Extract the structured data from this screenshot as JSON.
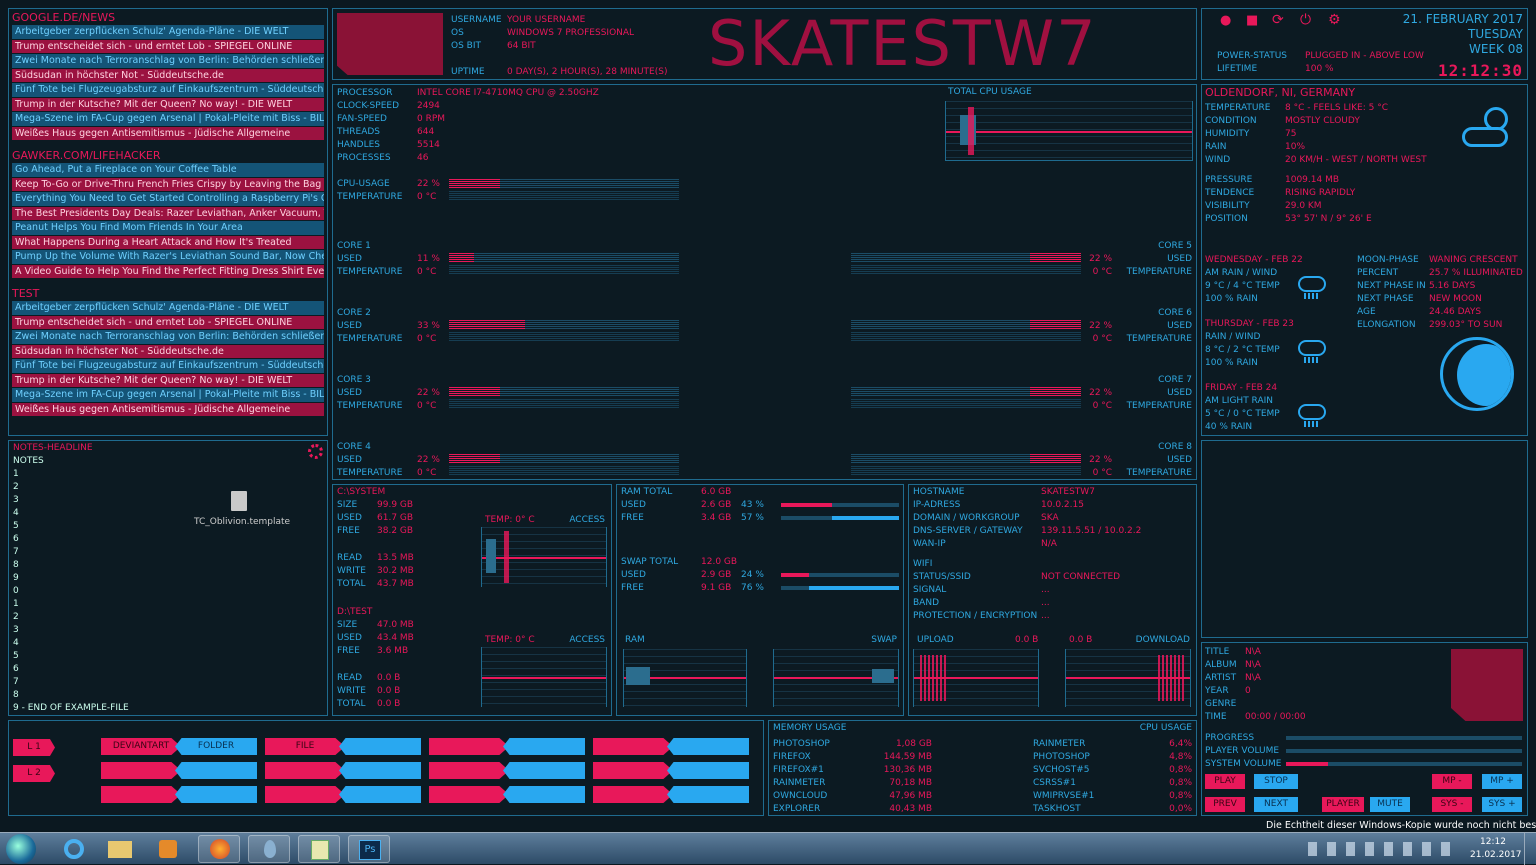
{
  "news": {
    "sections": [
      {
        "title": "GOOGLE.DE/NEWS",
        "items": [
          "Arbeitgeber zerpflücken Schulz' Agenda-Pläne - DIE WELT",
          "Trump entscheidet sich - und erntet Lob - SPIEGEL ONLINE",
          "Zwei Monate nach Terroranschlag von Berlin: Behörden schließen Fuss...",
          "Südsudan in höchster Not - Süddeutsche.de",
          "Fünf Tote bei Flugzeugabsturz auf Einkaufszentrum - Süddeutsche.de",
          "Trump in der Kutsche? Mit der Queen? No way! - DIE WELT",
          "Mega-Szene im FA-Cup gegen Arsenal | Pokal-Pleite mit Biss - BILD",
          "Weißes Haus gegen Antisemitismus - Jüdische Allgemeine"
        ]
      },
      {
        "title": "GAWKER.COM/LIFEHACKER",
        "items": [
          "Go Ahead, Put a Fireplace on Your Coffee Table",
          "Keep To-Go or Drive-Thru French Fries Crispy by Leaving the Bag Open",
          "Everything You Need to Get Started Controlling a Raspberry Pi's GPIO...",
          "The Best Presidents Day Deals: Razer Leviathan, Anker Vacuum, Tiny P...",
          "Peanut Helps You Find Mom Friends In Your Area",
          "What Happens During a Heart Attack and How It's Treated",
          "Pump Up the Volume With Razer's Leviathan Sound Bar, Now Cheaper...",
          "A Video Guide to Help You Find the Perfect Fitting Dress Shirt Every Ti..."
        ]
      },
      {
        "title": "TEST",
        "items": [
          "Arbeitgeber zerpflücken Schulz' Agenda-Pläne - DIE WELT",
          "Trump entscheidet sich - und erntet Lob - SPIEGEL ONLINE",
          "Zwei Monate nach Terroranschlag von Berlin: Behörden schließen Fuss...",
          "Südsudan in höchster Not - Süddeutsche.de",
          "Fünf Tote bei Flugzeugabsturz auf Einkaufszentrum - Süddeutsche.de",
          "Trump in der Kutsche? Mit der Queen? No way! - DIE WELT",
          "Mega-Szene im FA-Cup gegen Arsenal | Pokal-Pleite mit Biss - BILD",
          "Weißes Haus gegen Antisemitismus - Jüdische Allgemeine"
        ]
      }
    ]
  },
  "notes": {
    "headline": "NOTES-HEADLINE",
    "label": "NOTES",
    "lines": [
      "1",
      "2",
      "3",
      "4",
      "5",
      "6",
      "7",
      "8",
      "9",
      "0",
      "1",
      "2",
      "3",
      "4",
      "5",
      "6",
      "7",
      "8",
      "9 - END OF EXAMPLE-FILE"
    ],
    "file_name": "TC_Oblivion.template"
  },
  "user": {
    "hostname_big": "SKATESTW7",
    "labels": [
      "USERNAME",
      "OS",
      "OS BIT",
      "UPTIME"
    ],
    "values": [
      "YOUR USERNAME",
      "WINDOWS 7 PROFESSIONAL",
      "64 BIT",
      "0 DAY(S), 2 HOUR(S), 28 MINUTE(S)"
    ]
  },
  "status": {
    "date": "21. FEBRUARY 2017",
    "day": "TUESDAY",
    "week": "WEEK 08",
    "power_label": "POWER-STATUS",
    "power_value": "PLUGGED IN - ABOVE LOW",
    "lifetime_label": "LIFETIME",
    "lifetime_value": "100 %",
    "clock": "12:12:30"
  },
  "cpu": {
    "labels": [
      "PROCESSOR",
      "CLOCK-SPEED",
      "FAN-SPEED",
      "THREADS",
      "HANDLES",
      "PROCESSES"
    ],
    "values": [
      "INTEL CORE I7-4710MQ CPU @ 2.50GHZ",
      "2494",
      "0 RPM",
      "644",
      "5514",
      "46"
    ],
    "usage_label": "CPU-USAGE",
    "usage_value": "22 %",
    "usage_pct": 22,
    "temp_label": "TEMPERATURE",
    "temp_value": "0 °C",
    "graph_title": "TOTAL CPU USAGE",
    "used_label": "USED",
    "cores": [
      {
        "name": "CORE 1",
        "used": "11 %",
        "pct": 11,
        "temp": "0 °C"
      },
      {
        "name": "CORE 2",
        "used": "33 %",
        "pct": 33,
        "temp": "0 °C"
      },
      {
        "name": "CORE 3",
        "used": "22 %",
        "pct": 22,
        "temp": "0 °C"
      },
      {
        "name": "CORE 4",
        "used": "22 %",
        "pct": 22,
        "temp": "0 °C"
      },
      {
        "name": "CORE 5",
        "used": "22 %",
        "pct": 22,
        "temp": "0 °C"
      },
      {
        "name": "CORE 6",
        "used": "22 %",
        "pct": 22,
        "temp": "0 °C"
      },
      {
        "name": "CORE 7",
        "used": "22 %",
        "pct": 22,
        "temp": "0 °C"
      },
      {
        "name": "CORE 8",
        "used": "22 %",
        "pct": 22,
        "temp": "0 °C"
      }
    ]
  },
  "weather": {
    "location": "OLDENDORF, NI, GERMANY",
    "labels": [
      "TEMPERATURE",
      "CONDITION",
      "HUMIDITY",
      "RAIN",
      "WIND"
    ],
    "values": [
      "8 °C - FEELS LIKE: 5 °C",
      "MOSTLY CLOUDY",
      "75",
      "10%",
      "20 KM/H - WEST / NORTH WEST"
    ],
    "labels2": [
      "PRESSURE",
      "TENDENCE",
      "VISIBILITY",
      "POSITION"
    ],
    "values2": [
      "1009.14 MB",
      "RISING RAPIDLY",
      "29.0 KM",
      "53° 57' N / 9° 26' E"
    ],
    "forecast": [
      {
        "day": "WEDNESDAY - FEB 22",
        "cond": "AM RAIN / WIND",
        "temp": "9 °C / 4 °C TEMP",
        "rain": "100 % RAIN"
      },
      {
        "day": "THURSDAY - FEB 23",
        "cond": "RAIN / WIND",
        "temp": "8 °C / 2 °C TEMP",
        "rain": "100 % RAIN"
      },
      {
        "day": "FRIDAY - FEB 24",
        "cond": "AM LIGHT RAIN",
        "temp": "5 °C / 0 °C TEMP",
        "rain": "40 % RAIN"
      }
    ],
    "moon_labels": [
      "MOON-PHASE",
      "PERCENT",
      "NEXT PHASE IN",
      "NEXT PHASE",
      "AGE",
      "ELONGATION"
    ],
    "moon_values": [
      "WANING CRESCENT",
      "25.7 % ILLUMINATED",
      "5.16 DAYS",
      "NEW MOON",
      "24.46 DAYS",
      "299.03° TO SUN"
    ]
  },
  "drives": {
    "c": {
      "name": "C:\\SYSTEM",
      "labels": [
        "SIZE",
        "USED",
        "FREE",
        "READ",
        "WRITE",
        "TOTAL"
      ],
      "values": [
        "99.9 GB",
        "61.7 GB",
        "38.2 GB",
        "13.5 MB",
        "30.2 MB",
        "43.7 MB"
      ],
      "temp": "TEMP: 0° C",
      "access": "ACCESS"
    },
    "d": {
      "name": "D:\\TEST",
      "labels": [
        "SIZE",
        "USED",
        "FREE",
        "READ",
        "WRITE",
        "TOTAL"
      ],
      "values": [
        "47.0 MB",
        "43.4 MB",
        "3.6 MB",
        "0.0 B",
        "0.0 B",
        "0.0 B"
      ],
      "temp": "TEMP: 0° C",
      "access": "ACCESS"
    }
  },
  "ram": {
    "labels": [
      "RAM TOTAL",
      "USED",
      "FREE"
    ],
    "values": [
      "6.0 GB",
      "2.6 GB",
      "3.4 GB"
    ],
    "pcts": [
      "43 %",
      "57 %"
    ],
    "used_pct": 43,
    "swap_labels": [
      "SWAP TOTAL",
      "USED",
      "FREE"
    ],
    "swap_values": [
      "12.0 GB",
      "2.9 GB",
      "9.1 GB"
    ],
    "swap_pcts": [
      "24 %",
      "76 %"
    ],
    "swap_used_pct": 24,
    "ram_graph": "RAM",
    "swap_graph": "SWAP"
  },
  "network": {
    "labels": [
      "HOSTNAME",
      "IP-ADRESS",
      "DOMAIN / WORKGROUP",
      "DNS-SERVER / GATEWAY",
      "WAN-IP"
    ],
    "values": [
      "SKATESTW7",
      "10.0.2.15",
      "SKA",
      "139.11.5.51 / 10.0.2.2",
      "N/A"
    ],
    "wifi_labels": [
      "WIFI",
      "STATUS/SSID",
      "SIGNAL",
      "BAND",
      "PROTECTION / ENCRYPTION"
    ],
    "wifi_values": [
      "",
      "NOT CONNECTED",
      "...",
      "...",
      "..."
    ],
    "upload": "UPLOAD",
    "upload_val": "0.0 B",
    "download": "DOWNLOAD",
    "download_val": "0.0 B"
  },
  "launcher": {
    "l1": "L 1",
    "l2": "L 2",
    "row1": [
      "DEVIANTART",
      "FOLDER",
      "FILE",
      "",
      "",
      "",
      "",
      ""
    ]
  },
  "memory": {
    "title": "MEMORY USAGE",
    "cpu_title": "CPU USAGE",
    "mem": [
      [
        "PHOTOSHOP",
        "1,08 GB"
      ],
      [
        "FIREFOX",
        "144,59 MB"
      ],
      [
        "FIREFOX#1",
        "130,36 MB"
      ],
      [
        "RAINMETER",
        "70,18 MB"
      ],
      [
        "OWNCLOUD",
        "47,96 MB"
      ],
      [
        "EXPLORER",
        "40,43 MB"
      ]
    ],
    "cpu": [
      [
        "RAINMETER",
        "6,4%"
      ],
      [
        "PHOTOSHOP",
        "4,8%"
      ],
      [
        "SVCHOST#5",
        "0,8%"
      ],
      [
        "CSRSS#1",
        "0,8%"
      ],
      [
        "WMIPRVSE#1",
        "0,8%"
      ],
      [
        "TASKHOST",
        "0,0%"
      ]
    ]
  },
  "player": {
    "labels": [
      "TITLE",
      "ALBUM",
      "ARTIST",
      "YEAR",
      "GENRE",
      "TIME"
    ],
    "values": [
      "N\\A",
      "N\\A",
      "N\\A",
      "0",
      "",
      "00:00 / 00:00"
    ],
    "progress": "PROGRESS",
    "player_volume": "PLAYER VOLUME",
    "system_volume": "SYSTEM VOLUME",
    "system_volume_pct": 18,
    "buttons": {
      "play": "PLAY",
      "stop": "STOP",
      "prev": "PREV",
      "next": "NEXT",
      "player": "PLAYER",
      "mute": "MUTE",
      "mp_minus": "MP -",
      "mp_plus": "MP +",
      "sys_minus": "SYS -",
      "sys_plus": "SYS +"
    }
  },
  "taskbar": {
    "time": "12:12",
    "date": "21.02.2017",
    "watermark": "Die Echtheit dieser Windows-Kopie wurde noch nicht bestätigt."
  },
  "colors": {
    "pink": "#e8185a",
    "blue": "#2fa8e0",
    "background": "#0b1820"
  }
}
